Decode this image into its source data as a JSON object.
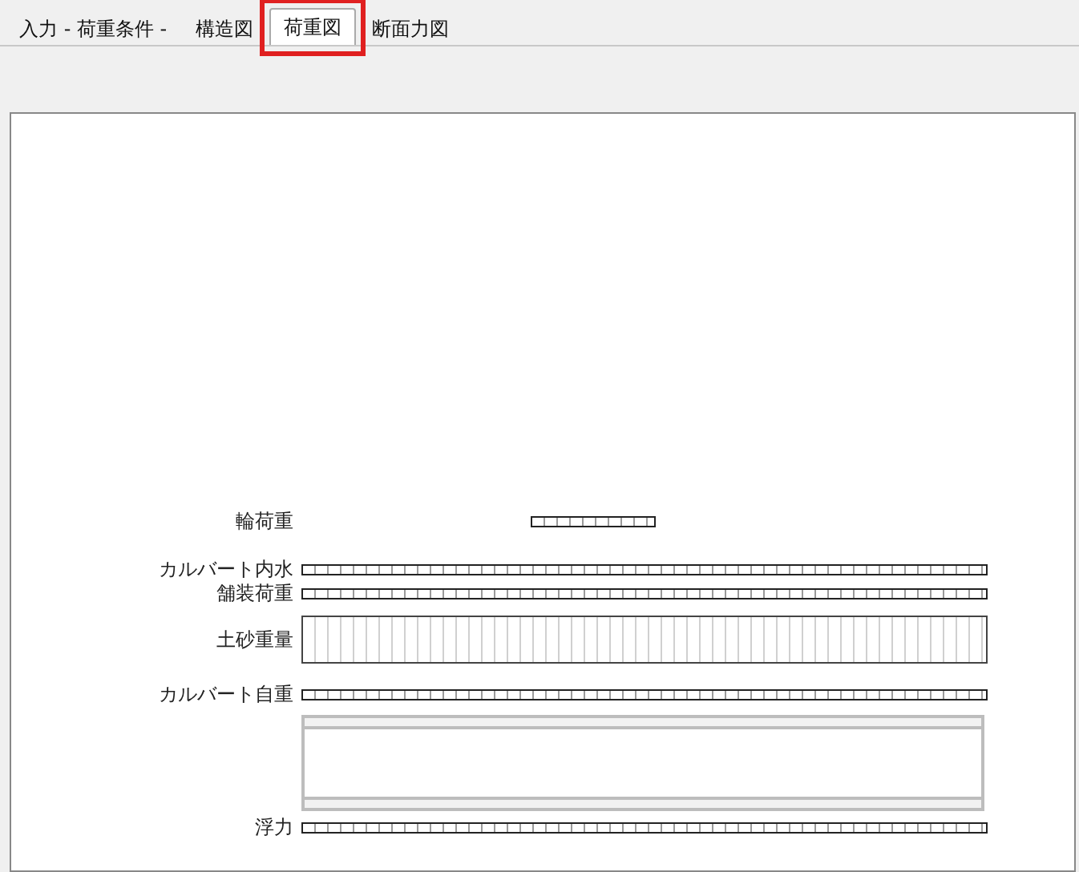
{
  "tabs": [
    {
      "label": "入力 - 荷重条件 -",
      "selected": false
    },
    {
      "label": "構造図",
      "selected": false
    },
    {
      "label": "荷重図",
      "selected": true
    },
    {
      "label": "断面力図",
      "selected": false
    }
  ],
  "loads": [
    {
      "kind": "wheel",
      "label": "輪荷重"
    },
    {
      "kind": "strip",
      "label": "カルバート内水"
    },
    {
      "kind": "strip",
      "label": "舗装荷重"
    },
    {
      "kind": "block",
      "label": "土砂重量"
    },
    {
      "kind": "strip",
      "label": "カルバート自重"
    },
    {
      "kind": "culvert"
    },
    {
      "kind": "strip",
      "label": "浮力"
    }
  ]
}
